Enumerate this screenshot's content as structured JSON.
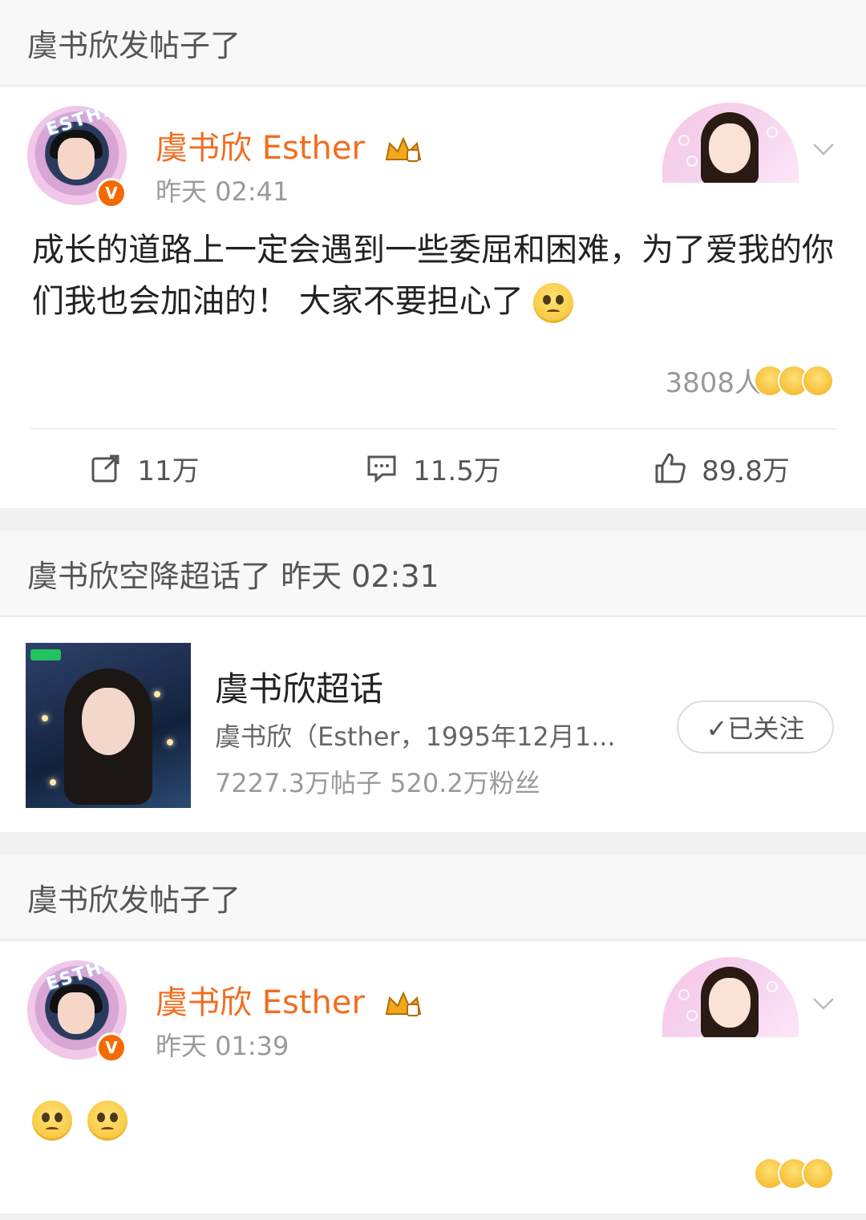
{
  "feed": [
    {
      "header": "虞书欣发帖子了",
      "author": "虞书欣 Esther",
      "time": "昨天 02:41",
      "avatar_ring_text": "ESTHER",
      "verified_badge": "V",
      "text": "成长的道路上一定会遇到一些委屈和困难，为了爱我的你们我也会加油的！ 大家不要担心了",
      "reaction_count": "3808人",
      "actions": {
        "repost": "11万",
        "comment": "11.5万",
        "like": "89.8万"
      }
    },
    {
      "header": "虞书欣空降超话了 昨天 02:31",
      "topic": {
        "title": "虞书欣超话",
        "desc": "虞书欣（Esther，1995年12月1...",
        "stats": "7227.3万帖子  520.2万粉丝",
        "follow_label": "✓已关注"
      }
    },
    {
      "header": "虞书欣发帖子了",
      "author": "虞书欣 Esther",
      "time": "昨天 01:39",
      "avatar_ring_text": "ESTHER",
      "verified_badge": "V"
    }
  ],
  "colors": {
    "author": "#f26d1f",
    "verified": "#f56a00",
    "muted": "#9a9a9a"
  }
}
